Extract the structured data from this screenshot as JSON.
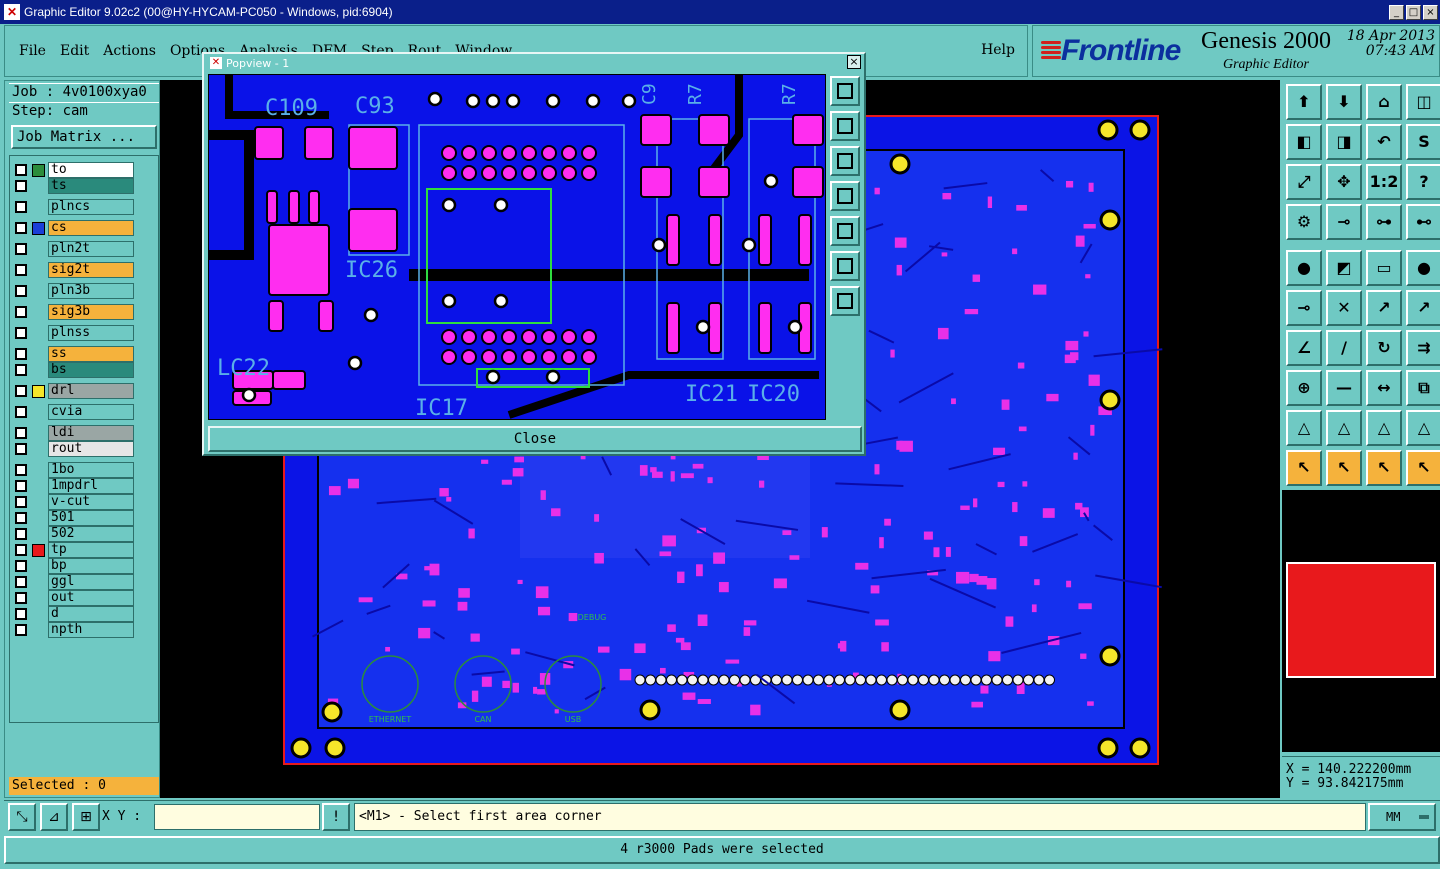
{
  "window": {
    "title": "Graphic Editor 9.02c2 (00@HY-HYCAM-PC050 - Windows, pid:6904)",
    "minimize": "_",
    "maximize": "□",
    "close": "×"
  },
  "menu": {
    "items": [
      "File",
      "Edit",
      "Actions",
      "Options",
      "Analysis",
      "DFM",
      "Step",
      "Rout",
      "Window"
    ],
    "help": "Help"
  },
  "brand": {
    "logo": "Frontline",
    "product": "Genesis 2000",
    "subtitle": "Graphic Editor",
    "date": "18 Apr 2013",
    "time": "07:43 AM"
  },
  "left": {
    "job": "Job : 4v0100xya0",
    "step": "Step: cam",
    "job_matrix": "Job Matrix ...",
    "selected": "Selected : 0",
    "layers": [
      {
        "name": "to",
        "color": "#2c8c3c",
        "bg": "#ffffff"
      },
      {
        "name": "ts",
        "color": "",
        "bg": "#2a8a7c"
      },
      {
        "name": "plncs",
        "color": "",
        "bg": "#6fc9c3"
      },
      {
        "name": "cs",
        "color": "#1b3fd8",
        "bg": "#f5b23c"
      },
      {
        "name": "pln2t",
        "color": "",
        "bg": "#6fc9c3"
      },
      {
        "name": "sig2t",
        "color": "",
        "bg": "#f5b23c"
      },
      {
        "name": "pln3b",
        "color": "",
        "bg": "#6fc9c3"
      },
      {
        "name": "sig3b",
        "color": "",
        "bg": "#f5b23c"
      },
      {
        "name": "plnss",
        "color": "",
        "bg": "#6fc9c3"
      },
      {
        "name": "ss",
        "color": "",
        "bg": "#f5b23c"
      },
      {
        "name": "bs",
        "color": "",
        "bg": "#2a8a7c"
      },
      {
        "name": "drl",
        "color": "#f5e62a",
        "bg": "#9aa6a4"
      },
      {
        "name": "cvia",
        "color": "",
        "bg": "#6fc9c3"
      },
      {
        "name": "ldi",
        "color": "",
        "bg": "#9aa6a4"
      },
      {
        "name": "rout",
        "color": "",
        "bg": "#e6e6e6"
      },
      {
        "name": "1bo",
        "color": "",
        "bg": "#6fc9c3"
      },
      {
        "name": "1mpdrl",
        "color": "",
        "bg": "#6fc9c3"
      },
      {
        "name": "v-cut",
        "color": "",
        "bg": "#6fc9c3"
      },
      {
        "name": "501",
        "color": "",
        "bg": "#6fc9c3"
      },
      {
        "name": "502",
        "color": "",
        "bg": "#6fc9c3"
      },
      {
        "name": "tp",
        "color": "#e8191c",
        "bg": "#6fc9c3"
      },
      {
        "name": "bp",
        "color": "",
        "bg": "#6fc9c3"
      },
      {
        "name": "ggl",
        "color": "",
        "bg": "#6fc9c3"
      },
      {
        "name": "out",
        "color": "",
        "bg": "#6fc9c3"
      },
      {
        "name": "d",
        "color": "",
        "bg": "#6fc9c3"
      },
      {
        "name": "npth",
        "color": "",
        "bg": "#6fc9c3"
      }
    ]
  },
  "popview": {
    "title": "Popview - 1",
    "close_label": "Close",
    "close_x": "×",
    "refdes": [
      "C109",
      "C93",
      "IC26",
      "IC17",
      "LC22",
      "IC21",
      "IC20",
      "C9",
      "R7",
      "R7"
    ]
  },
  "board": {
    "silk_labels": [
      "ETHERNET",
      "CAN",
      "USB",
      "DEBUG"
    ]
  },
  "coords": {
    "x": "X =  140.222200mm",
    "y": "Y =  93.842175mm"
  },
  "bottom": {
    "xy_label": "X Y :",
    "xy_value": "",
    "prompt": "<M1> - Select first area corner",
    "units": "MM",
    "status": "4 r3000 Pads were selected"
  }
}
